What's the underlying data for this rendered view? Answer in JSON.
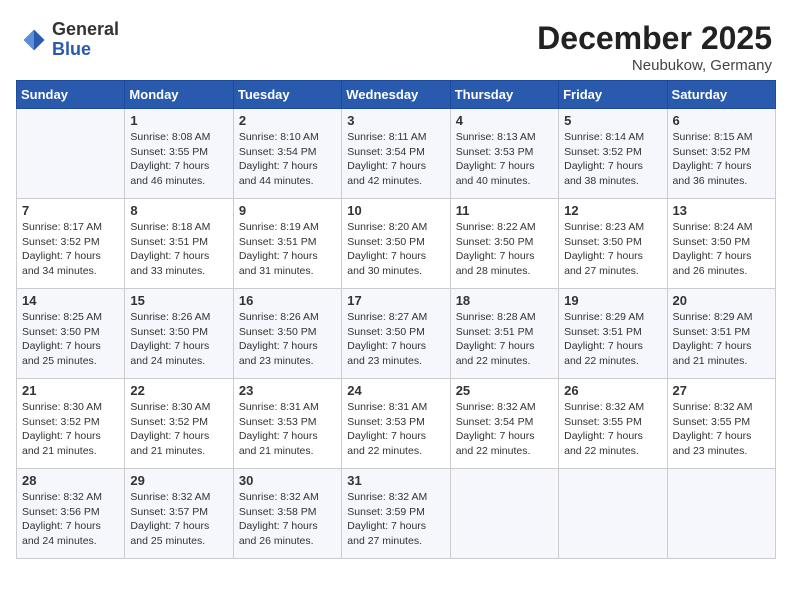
{
  "header": {
    "logo_general": "General",
    "logo_blue": "Blue",
    "month": "December 2025",
    "location": "Neubukow, Germany"
  },
  "weekdays": [
    "Sunday",
    "Monday",
    "Tuesday",
    "Wednesday",
    "Thursday",
    "Friday",
    "Saturday"
  ],
  "weeks": [
    [
      {
        "day": "",
        "sunrise": "",
        "sunset": "",
        "daylight": ""
      },
      {
        "day": "1",
        "sunrise": "Sunrise: 8:08 AM",
        "sunset": "Sunset: 3:55 PM",
        "daylight": "Daylight: 7 hours and 46 minutes."
      },
      {
        "day": "2",
        "sunrise": "Sunrise: 8:10 AM",
        "sunset": "Sunset: 3:54 PM",
        "daylight": "Daylight: 7 hours and 44 minutes."
      },
      {
        "day": "3",
        "sunrise": "Sunrise: 8:11 AM",
        "sunset": "Sunset: 3:54 PM",
        "daylight": "Daylight: 7 hours and 42 minutes."
      },
      {
        "day": "4",
        "sunrise": "Sunrise: 8:13 AM",
        "sunset": "Sunset: 3:53 PM",
        "daylight": "Daylight: 7 hours and 40 minutes."
      },
      {
        "day": "5",
        "sunrise": "Sunrise: 8:14 AM",
        "sunset": "Sunset: 3:52 PM",
        "daylight": "Daylight: 7 hours and 38 minutes."
      },
      {
        "day": "6",
        "sunrise": "Sunrise: 8:15 AM",
        "sunset": "Sunset: 3:52 PM",
        "daylight": "Daylight: 7 hours and 36 minutes."
      }
    ],
    [
      {
        "day": "7",
        "sunrise": "Sunrise: 8:17 AM",
        "sunset": "Sunset: 3:52 PM",
        "daylight": "Daylight: 7 hours and 34 minutes."
      },
      {
        "day": "8",
        "sunrise": "Sunrise: 8:18 AM",
        "sunset": "Sunset: 3:51 PM",
        "daylight": "Daylight: 7 hours and 33 minutes."
      },
      {
        "day": "9",
        "sunrise": "Sunrise: 8:19 AM",
        "sunset": "Sunset: 3:51 PM",
        "daylight": "Daylight: 7 hours and 31 minutes."
      },
      {
        "day": "10",
        "sunrise": "Sunrise: 8:20 AM",
        "sunset": "Sunset: 3:50 PM",
        "daylight": "Daylight: 7 hours and 30 minutes."
      },
      {
        "day": "11",
        "sunrise": "Sunrise: 8:22 AM",
        "sunset": "Sunset: 3:50 PM",
        "daylight": "Daylight: 7 hours and 28 minutes."
      },
      {
        "day": "12",
        "sunrise": "Sunrise: 8:23 AM",
        "sunset": "Sunset: 3:50 PM",
        "daylight": "Daylight: 7 hours and 27 minutes."
      },
      {
        "day": "13",
        "sunrise": "Sunrise: 8:24 AM",
        "sunset": "Sunset: 3:50 PM",
        "daylight": "Daylight: 7 hours and 26 minutes."
      }
    ],
    [
      {
        "day": "14",
        "sunrise": "Sunrise: 8:25 AM",
        "sunset": "Sunset: 3:50 PM",
        "daylight": "Daylight: 7 hours and 25 minutes."
      },
      {
        "day": "15",
        "sunrise": "Sunrise: 8:26 AM",
        "sunset": "Sunset: 3:50 PM",
        "daylight": "Daylight: 7 hours and 24 minutes."
      },
      {
        "day": "16",
        "sunrise": "Sunrise: 8:26 AM",
        "sunset": "Sunset: 3:50 PM",
        "daylight": "Daylight: 7 hours and 23 minutes."
      },
      {
        "day": "17",
        "sunrise": "Sunrise: 8:27 AM",
        "sunset": "Sunset: 3:50 PM",
        "daylight": "Daylight: 7 hours and 23 minutes."
      },
      {
        "day": "18",
        "sunrise": "Sunrise: 8:28 AM",
        "sunset": "Sunset: 3:51 PM",
        "daylight": "Daylight: 7 hours and 22 minutes."
      },
      {
        "day": "19",
        "sunrise": "Sunrise: 8:29 AM",
        "sunset": "Sunset: 3:51 PM",
        "daylight": "Daylight: 7 hours and 22 minutes."
      },
      {
        "day": "20",
        "sunrise": "Sunrise: 8:29 AM",
        "sunset": "Sunset: 3:51 PM",
        "daylight": "Daylight: 7 hours and 21 minutes."
      }
    ],
    [
      {
        "day": "21",
        "sunrise": "Sunrise: 8:30 AM",
        "sunset": "Sunset: 3:52 PM",
        "daylight": "Daylight: 7 hours and 21 minutes."
      },
      {
        "day": "22",
        "sunrise": "Sunrise: 8:30 AM",
        "sunset": "Sunset: 3:52 PM",
        "daylight": "Daylight: 7 hours and 21 minutes."
      },
      {
        "day": "23",
        "sunrise": "Sunrise: 8:31 AM",
        "sunset": "Sunset: 3:53 PM",
        "daylight": "Daylight: 7 hours and 21 minutes."
      },
      {
        "day": "24",
        "sunrise": "Sunrise: 8:31 AM",
        "sunset": "Sunset: 3:53 PM",
        "daylight": "Daylight: 7 hours and 22 minutes."
      },
      {
        "day": "25",
        "sunrise": "Sunrise: 8:32 AM",
        "sunset": "Sunset: 3:54 PM",
        "daylight": "Daylight: 7 hours and 22 minutes."
      },
      {
        "day": "26",
        "sunrise": "Sunrise: 8:32 AM",
        "sunset": "Sunset: 3:55 PM",
        "daylight": "Daylight: 7 hours and 22 minutes."
      },
      {
        "day": "27",
        "sunrise": "Sunrise: 8:32 AM",
        "sunset": "Sunset: 3:55 PM",
        "daylight": "Daylight: 7 hours and 23 minutes."
      }
    ],
    [
      {
        "day": "28",
        "sunrise": "Sunrise: 8:32 AM",
        "sunset": "Sunset: 3:56 PM",
        "daylight": "Daylight: 7 hours and 24 minutes."
      },
      {
        "day": "29",
        "sunrise": "Sunrise: 8:32 AM",
        "sunset": "Sunset: 3:57 PM",
        "daylight": "Daylight: 7 hours and 25 minutes."
      },
      {
        "day": "30",
        "sunrise": "Sunrise: 8:32 AM",
        "sunset": "Sunset: 3:58 PM",
        "daylight": "Daylight: 7 hours and 26 minutes."
      },
      {
        "day": "31",
        "sunrise": "Sunrise: 8:32 AM",
        "sunset": "Sunset: 3:59 PM",
        "daylight": "Daylight: 7 hours and 27 minutes."
      },
      {
        "day": "",
        "sunrise": "",
        "sunset": "",
        "daylight": ""
      },
      {
        "day": "",
        "sunrise": "",
        "sunset": "",
        "daylight": ""
      },
      {
        "day": "",
        "sunrise": "",
        "sunset": "",
        "daylight": ""
      }
    ]
  ]
}
